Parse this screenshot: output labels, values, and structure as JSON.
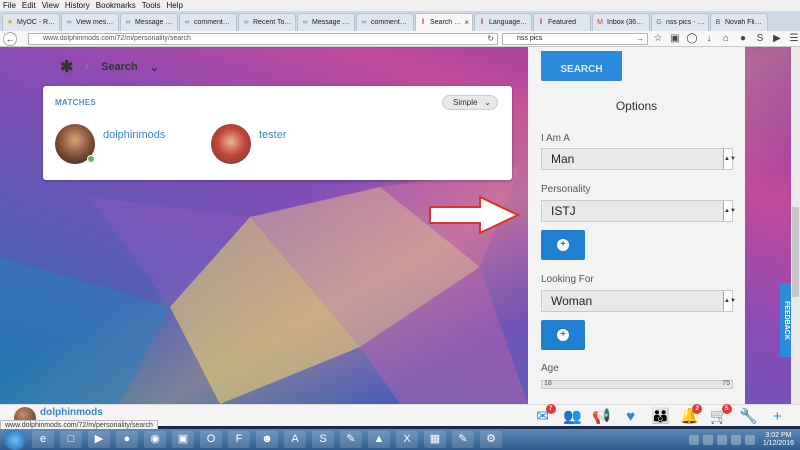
{
  "browser": {
    "menu": [
      "File",
      "Edit",
      "View",
      "History",
      "Bookmarks",
      "Tools",
      "Help"
    ],
    "tabs": [
      {
        "label": "MyOC - Reg...",
        "icon": "star-icon",
        "color": "#e8a400"
      },
      {
        "label": "View messa...",
        "icon": "infinity-icon",
        "color": "#3a86c8"
      },
      {
        "label": "Message to ...",
        "icon": "infinity-icon",
        "color": "#3a86c8"
      },
      {
        "label": "comments :...",
        "icon": "infinity-icon",
        "color": "#3a86c8"
      },
      {
        "label": "Recent Topi...",
        "icon": "infinity-icon",
        "color": "#3a86c8"
      },
      {
        "label": "Message to ...",
        "icon": "infinity-icon",
        "color": "#3a86c8"
      },
      {
        "label": "comments :...",
        "icon": "infinity-icon",
        "color": "#3a86c8"
      },
      {
        "label": "Search f...",
        "icon": "pause-icon",
        "color": "#d9342b",
        "active": true
      },
      {
        "label": "Language S...",
        "icon": "pause-icon",
        "color": "#d9342b"
      },
      {
        "label": "Featured",
        "icon": "pause-icon",
        "color": "#d9342b"
      },
      {
        "label": "Inbox (369) ...",
        "icon": "gmail-icon",
        "color": "#d9342b"
      },
      {
        "label": "nss pics - Go...",
        "icon": "google-icon",
        "color": "#3a86c8"
      },
      {
        "label": "Novah Fligh...",
        "icon": "b-icon",
        "color": "#3355aa"
      }
    ],
    "url": "www.dolphinmods.com/72/m/personality/search",
    "search_query": "nss pics",
    "status_url": "www.dolphinmods.com/72/m/personality/search"
  },
  "page": {
    "breadcrumb_label": "Search",
    "matches": {
      "heading": "MATCHES",
      "view_mode": "Simple",
      "users": [
        {
          "name": "dolphinmods",
          "online": true
        },
        {
          "name": "tester",
          "online": false
        }
      ]
    },
    "options": {
      "search_button": "SEARCH",
      "title": "Options",
      "i_am_label": "I Am A",
      "i_am_value": "Man",
      "personality_label": "Personality",
      "personality_value": "ISTJ",
      "looking_for_label": "Looking For",
      "looking_for_value": "Woman",
      "age_label": "Age",
      "age_min": "18",
      "age_max": "75"
    },
    "feedback_label": "FEEDBACK",
    "bottom_user": "dolphinmods",
    "app_icons": [
      {
        "name": "mail-icon",
        "badge": "7"
      },
      {
        "name": "users-icon",
        "badge": ""
      },
      {
        "name": "megaphone-icon",
        "badge": ""
      },
      {
        "name": "heart-icon",
        "badge": ""
      },
      {
        "name": "group-icon",
        "badge": ""
      },
      {
        "name": "bell-icon",
        "badge": "2"
      },
      {
        "name": "cart-icon",
        "badge": "5"
      },
      {
        "name": "wrench-icon",
        "badge": ""
      },
      {
        "name": "plus-icon",
        "badge": ""
      }
    ]
  },
  "taskbar": {
    "time": "3:02 PM",
    "date": "1/12/2016"
  }
}
